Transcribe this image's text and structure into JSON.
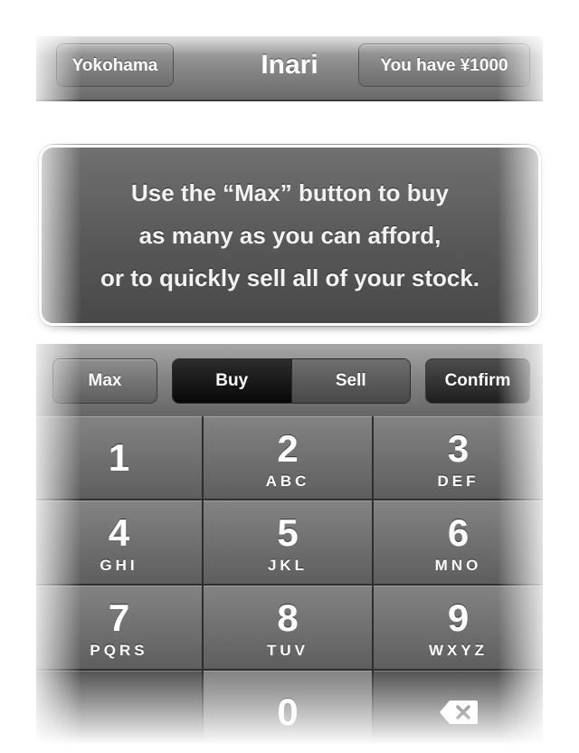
{
  "navbar": {
    "left_button": "Yokohama",
    "title": "Inari",
    "right_button": "You have ¥1000"
  },
  "tooltip": {
    "lines": [
      "Use the “Max” button  to buy",
      "as many as you can afford,",
      "or to quickly sell all of your stock."
    ]
  },
  "toolbar": {
    "max_label": "Max",
    "segments": [
      {
        "label": "Buy",
        "selected": true
      },
      {
        "label": "Sell",
        "selected": false
      }
    ],
    "confirm_label": "Confirm"
  },
  "keypad": {
    "keys": [
      {
        "number": "1",
        "letters": ""
      },
      {
        "number": "2",
        "letters": "ABC"
      },
      {
        "number": "3",
        "letters": "DEF"
      },
      {
        "number": "4",
        "letters": "GHI"
      },
      {
        "number": "5",
        "letters": "JKL"
      },
      {
        "number": "6",
        "letters": "MNO"
      },
      {
        "number": "7",
        "letters": "PQRS"
      },
      {
        "number": "8",
        "letters": "TUV"
      },
      {
        "number": "9",
        "letters": "WXYZ"
      },
      {
        "number": "",
        "letters": ""
      },
      {
        "number": "0",
        "letters": ""
      }
    ],
    "backspace_icon": "backspace-icon"
  }
}
